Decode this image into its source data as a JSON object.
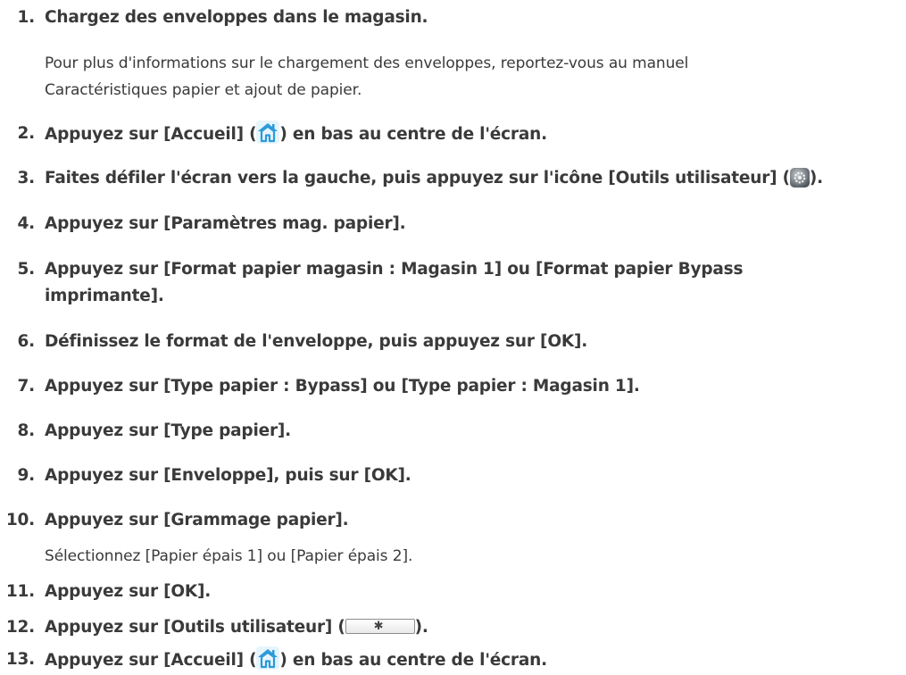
{
  "steps": [
    {
      "num": "1.",
      "text": "Chargez des enveloppes dans le magasin.",
      "body": [
        "Pour plus d'informations sur le chargement des enveloppes, reportez-vous au manuel",
        "Caractéristiques papier et ajout de papier."
      ]
    },
    {
      "num": "2.",
      "before": "Appuyez sur [Accueil] (",
      "icon": "home-icon",
      "after": ") en bas au centre de l'écran."
    },
    {
      "num": "3.",
      "before": "Faites défiler l'écran vers la gauche, puis appuyez sur l'icône [Outils utilisateur] (",
      "icon": "user-tools-icon",
      "after": ")."
    },
    {
      "num": "4.",
      "text": "Appuyez sur [Paramètres mag. papier]."
    },
    {
      "num": "5.",
      "text": "Appuyez sur [Format papier magasin : Magasin 1] ou [Format papier Bypass imprimante]."
    },
    {
      "num": "6.",
      "text": "Définissez le format de l'enveloppe, puis appuyez sur [OK]."
    },
    {
      "num": "7.",
      "text": "Appuyez sur [Type papier : Bypass] ou [Type papier : Magasin 1]."
    },
    {
      "num": "8.",
      "text": "Appuyez sur [Type papier]."
    },
    {
      "num": "9.",
      "text": "Appuyez sur [Enveloppe], puis sur [OK]."
    },
    {
      "num": "10.",
      "text": "Appuyez sur [Grammage papier].",
      "body": [
        "Sélectionnez [Papier épais 1] ou [Papier épais 2]."
      ]
    },
    {
      "num": "11.",
      "text": "Appuyez sur [OK]."
    },
    {
      "num": "12.",
      "before": "Appuyez sur [Outils utilisateur] (",
      "icon": "user-tools-key-icon",
      "after": ")."
    },
    {
      "num": "13.",
      "before": "Appuyez sur [Accueil] (",
      "icon": "home-icon",
      "after": ") en bas au centre de l'écran."
    }
  ],
  "colors": {
    "text": "#3a3a3a",
    "home_icon_blue": "#2a9ad8",
    "tools_icon_gray": "#6f747a"
  }
}
